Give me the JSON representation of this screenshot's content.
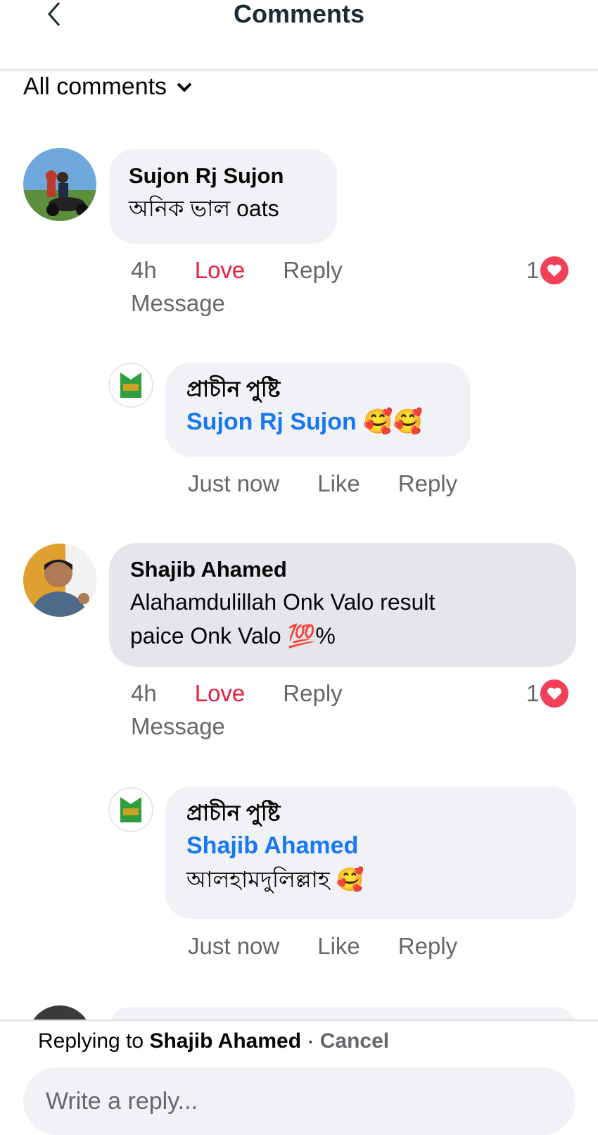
{
  "header": {
    "title": "Comments"
  },
  "filter": {
    "label": "All comments"
  },
  "comments": [
    {
      "author": "Sujon Rj Sujon",
      "text": "অনিক ভাল oats",
      "time": "4h",
      "love": "Love",
      "reply": "Reply",
      "message": "Message",
      "reaction_count": "1",
      "replies": [
        {
          "author": "প্রাচীন পুষ্টি",
          "mention": "Sujon Rj Sujon",
          "emoji": "🥰🥰",
          "time": "Just now",
          "like": "Like",
          "reply": "Reply"
        }
      ]
    },
    {
      "author": "Shajib Ahamed",
      "text_line1": "Alahamdulillah Onk Valo result",
      "text_line2": "paice Onk Valo 💯%",
      "time": "4h",
      "love": "Love",
      "reply": "Reply",
      "message": "Message",
      "reaction_count": "1",
      "replies": [
        {
          "author": "প্রাচীন পুষ্টি",
          "mention": "Shajib Ahamed",
          "text": "আলহামদুলিল্লাহ 🥰",
          "time": "Just now",
          "like": "Like",
          "reply": "Reply"
        }
      ]
    }
  ],
  "composer": {
    "replying_prefix": "Replying to",
    "replying_name": "Shajib Ahamed",
    "separator": "·",
    "cancel": "Cancel",
    "placeholder": "Write a reply..."
  },
  "colors": {
    "love": "#e41e3f",
    "mention": "#1877f2",
    "bubble": "#f0f2f5",
    "heart": "#f33e58"
  }
}
